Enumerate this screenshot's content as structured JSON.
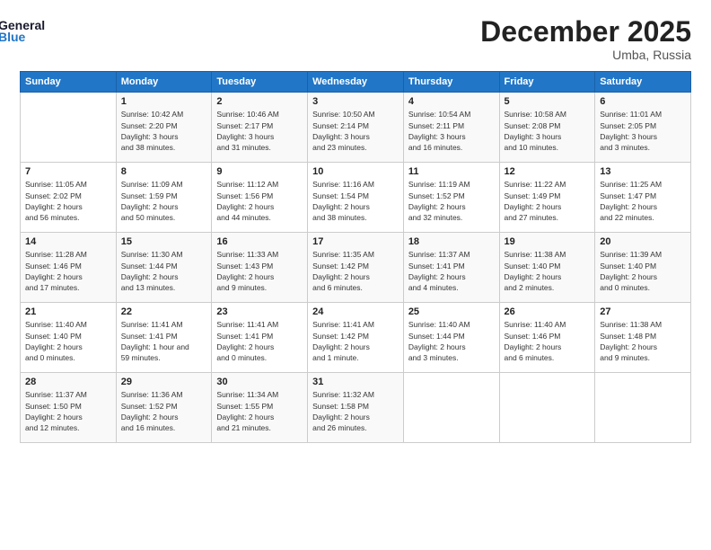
{
  "header": {
    "logo_line1": "General",
    "logo_line2": "Blue",
    "month": "December 2025",
    "location": "Umba, Russia"
  },
  "days_of_week": [
    "Sunday",
    "Monday",
    "Tuesday",
    "Wednesday",
    "Thursday",
    "Friday",
    "Saturday"
  ],
  "weeks": [
    [
      {
        "num": "",
        "info": ""
      },
      {
        "num": "1",
        "info": "Sunrise: 10:42 AM\nSunset: 2:20 PM\nDaylight: 3 hours\nand 38 minutes."
      },
      {
        "num": "2",
        "info": "Sunrise: 10:46 AM\nSunset: 2:17 PM\nDaylight: 3 hours\nand 31 minutes."
      },
      {
        "num": "3",
        "info": "Sunrise: 10:50 AM\nSunset: 2:14 PM\nDaylight: 3 hours\nand 23 minutes."
      },
      {
        "num": "4",
        "info": "Sunrise: 10:54 AM\nSunset: 2:11 PM\nDaylight: 3 hours\nand 16 minutes."
      },
      {
        "num": "5",
        "info": "Sunrise: 10:58 AM\nSunset: 2:08 PM\nDaylight: 3 hours\nand 10 minutes."
      },
      {
        "num": "6",
        "info": "Sunrise: 11:01 AM\nSunset: 2:05 PM\nDaylight: 3 hours\nand 3 minutes."
      }
    ],
    [
      {
        "num": "7",
        "info": "Sunrise: 11:05 AM\nSunset: 2:02 PM\nDaylight: 2 hours\nand 56 minutes."
      },
      {
        "num": "8",
        "info": "Sunrise: 11:09 AM\nSunset: 1:59 PM\nDaylight: 2 hours\nand 50 minutes."
      },
      {
        "num": "9",
        "info": "Sunrise: 11:12 AM\nSunset: 1:56 PM\nDaylight: 2 hours\nand 44 minutes."
      },
      {
        "num": "10",
        "info": "Sunrise: 11:16 AM\nSunset: 1:54 PM\nDaylight: 2 hours\nand 38 minutes."
      },
      {
        "num": "11",
        "info": "Sunrise: 11:19 AM\nSunset: 1:52 PM\nDaylight: 2 hours\nand 32 minutes."
      },
      {
        "num": "12",
        "info": "Sunrise: 11:22 AM\nSunset: 1:49 PM\nDaylight: 2 hours\nand 27 minutes."
      },
      {
        "num": "13",
        "info": "Sunrise: 11:25 AM\nSunset: 1:47 PM\nDaylight: 2 hours\nand 22 minutes."
      }
    ],
    [
      {
        "num": "14",
        "info": "Sunrise: 11:28 AM\nSunset: 1:46 PM\nDaylight: 2 hours\nand 17 minutes."
      },
      {
        "num": "15",
        "info": "Sunrise: 11:30 AM\nSunset: 1:44 PM\nDaylight: 2 hours\nand 13 minutes."
      },
      {
        "num": "16",
        "info": "Sunrise: 11:33 AM\nSunset: 1:43 PM\nDaylight: 2 hours\nand 9 minutes."
      },
      {
        "num": "17",
        "info": "Sunrise: 11:35 AM\nSunset: 1:42 PM\nDaylight: 2 hours\nand 6 minutes."
      },
      {
        "num": "18",
        "info": "Sunrise: 11:37 AM\nSunset: 1:41 PM\nDaylight: 2 hours\nand 4 minutes."
      },
      {
        "num": "19",
        "info": "Sunrise: 11:38 AM\nSunset: 1:40 PM\nDaylight: 2 hours\nand 2 minutes."
      },
      {
        "num": "20",
        "info": "Sunrise: 11:39 AM\nSunset: 1:40 PM\nDaylight: 2 hours\nand 0 minutes."
      }
    ],
    [
      {
        "num": "21",
        "info": "Sunrise: 11:40 AM\nSunset: 1:40 PM\nDaylight: 2 hours\nand 0 minutes."
      },
      {
        "num": "22",
        "info": "Sunrise: 11:41 AM\nSunset: 1:41 PM\nDaylight: 1 hour and\n59 minutes."
      },
      {
        "num": "23",
        "info": "Sunrise: 11:41 AM\nSunset: 1:41 PM\nDaylight: 2 hours\nand 0 minutes."
      },
      {
        "num": "24",
        "info": "Sunrise: 11:41 AM\nSunset: 1:42 PM\nDaylight: 2 hours\nand 1 minute."
      },
      {
        "num": "25",
        "info": "Sunrise: 11:40 AM\nSunset: 1:44 PM\nDaylight: 2 hours\nand 3 minutes."
      },
      {
        "num": "26",
        "info": "Sunrise: 11:40 AM\nSunset: 1:46 PM\nDaylight: 2 hours\nand 6 minutes."
      },
      {
        "num": "27",
        "info": "Sunrise: 11:38 AM\nSunset: 1:48 PM\nDaylight: 2 hours\nand 9 minutes."
      }
    ],
    [
      {
        "num": "28",
        "info": "Sunrise: 11:37 AM\nSunset: 1:50 PM\nDaylight: 2 hours\nand 12 minutes."
      },
      {
        "num": "29",
        "info": "Sunrise: 11:36 AM\nSunset: 1:52 PM\nDaylight: 2 hours\nand 16 minutes."
      },
      {
        "num": "30",
        "info": "Sunrise: 11:34 AM\nSunset: 1:55 PM\nDaylight: 2 hours\nand 21 minutes."
      },
      {
        "num": "31",
        "info": "Sunrise: 11:32 AM\nSunset: 1:58 PM\nDaylight: 2 hours\nand 26 minutes."
      },
      {
        "num": "",
        "info": ""
      },
      {
        "num": "",
        "info": ""
      },
      {
        "num": "",
        "info": ""
      }
    ]
  ]
}
